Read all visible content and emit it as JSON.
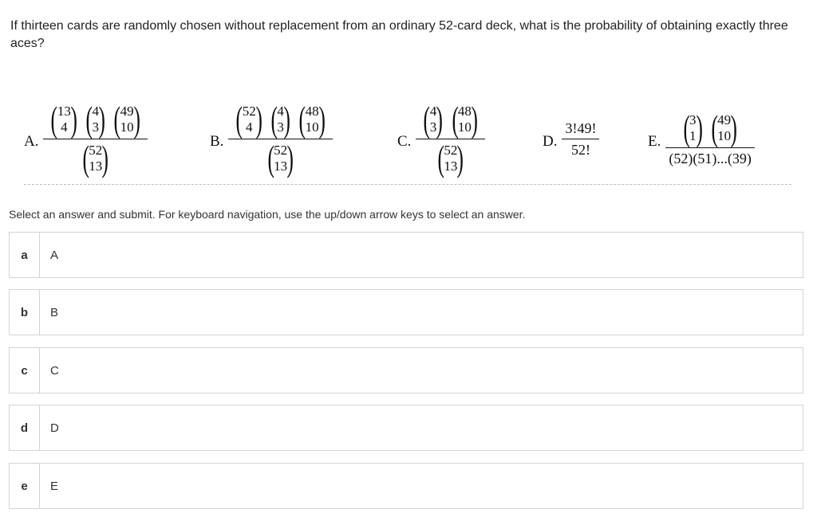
{
  "question": {
    "text": "If thirteen cards are randomly chosen without replacement from an ordinary 52-card deck, what is the probability of obtaining exactly three aces?"
  },
  "formulas": {
    "A": {
      "letter": "A.",
      "numerator": [
        {
          "n": "13",
          "k": "4"
        },
        {
          "n": "4",
          "k": "3"
        },
        {
          "n": "49",
          "k": "10"
        }
      ],
      "denominator": [
        {
          "n": "52",
          "k": "13"
        }
      ]
    },
    "B": {
      "letter": "B.",
      "numerator": [
        {
          "n": "52",
          "k": "4"
        },
        {
          "n": "4",
          "k": "3"
        },
        {
          "n": "48",
          "k": "10"
        }
      ],
      "denominator": [
        {
          "n": "52",
          "k": "13"
        }
      ]
    },
    "C": {
      "letter": "C.",
      "numerator": [
        {
          "n": "4",
          "k": "3"
        },
        {
          "n": "48",
          "k": "10"
        }
      ],
      "denominator": [
        {
          "n": "52",
          "k": "13"
        }
      ]
    },
    "D": {
      "letter": "D.",
      "numerator_text": "3!49!",
      "denominator_text": "52!"
    },
    "E": {
      "letter": "E.",
      "numerator": [
        {
          "n": "3",
          "k": "1"
        },
        {
          "n": "49",
          "k": "10"
        }
      ],
      "denominator_text": "(52)(51)...(39)"
    }
  },
  "instructions": "Select an answer and submit. For keyboard navigation, use the up/down arrow keys to select an answer.",
  "options": [
    {
      "key": "a",
      "label": "A"
    },
    {
      "key": "b",
      "label": "B"
    },
    {
      "key": "c",
      "label": "C"
    },
    {
      "key": "d",
      "label": "D"
    },
    {
      "key": "e",
      "label": "E"
    }
  ]
}
